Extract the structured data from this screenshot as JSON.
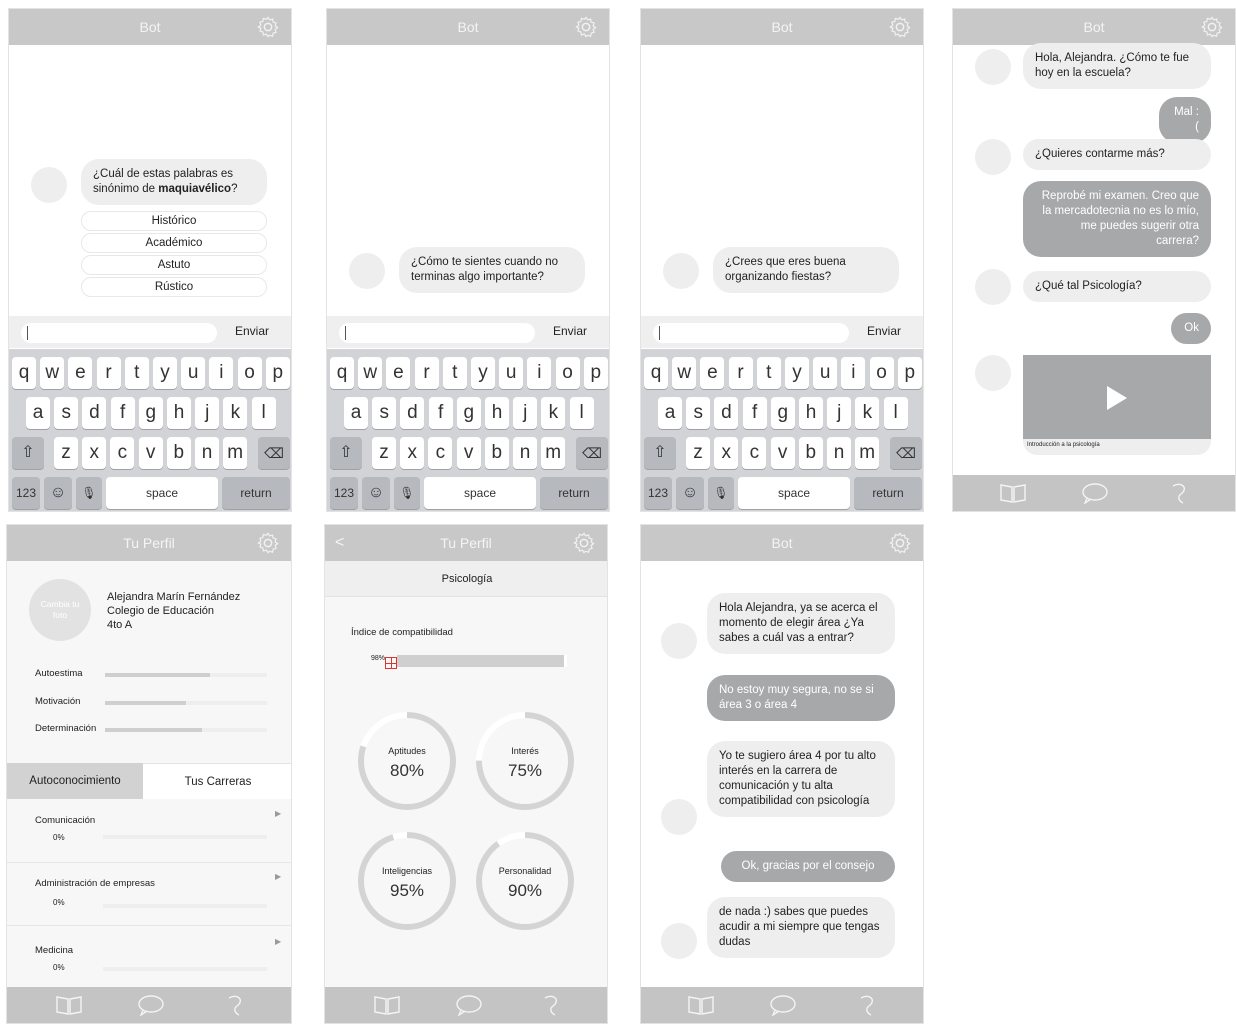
{
  "bot_title": "Bot",
  "profile_title": "Tu Perfil",
  "keyboard": {
    "row1": [
      "q",
      "w",
      "e",
      "r",
      "t",
      "y",
      "u",
      "i",
      "o",
      "p"
    ],
    "row2": [
      "a",
      "s",
      "d",
      "f",
      "g",
      "h",
      "j",
      "k",
      "l"
    ],
    "row3": [
      "z",
      "x",
      "c",
      "v",
      "b",
      "n",
      "m"
    ],
    "num_label": "123",
    "space_label": "space",
    "return_label": "return"
  },
  "send_label": "Enviar",
  "screen1": {
    "question": "¿Cuál de estas palabras es sinónimo de maquiavélico?",
    "question_prefix": "¿Cuál de estas palabras es sinónimo de ",
    "question_bold": "maquiavélico",
    "question_suffix": "?",
    "options": [
      "Histórico",
      "Académico",
      "Astuto",
      "Rústico"
    ]
  },
  "screen2": {
    "message": "¿Cómo te sientes cuando no terminas algo importante?"
  },
  "screen3": {
    "message": "¿Crees que eres buena organizando fiestas?"
  },
  "screen4": {
    "messages": [
      {
        "from": "bot",
        "text": "Hola, Alejandra. ¿Cómo te fue hoy en la escuela?"
      },
      {
        "from": "user",
        "text": "Mal :("
      },
      {
        "from": "bot",
        "text": "¿Quieres contarme más?"
      },
      {
        "from": "user",
        "text": "Reprobé mi examen. Creo que la mercadotecnia no es lo mío, me puedes sugerir otra carrera?"
      },
      {
        "from": "bot",
        "text": "¿Qué tal Psicología?"
      },
      {
        "from": "user",
        "text": "Ok"
      }
    ],
    "video_caption": "Introducción a la psicología"
  },
  "screen5": {
    "avatar_label": "Cambia tu foto",
    "name": "Alejandra Marín Fernández",
    "school": "Colegio de Educación",
    "grade": "4to A",
    "traits": [
      {
        "label": "Autoestima",
        "level": 0.65
      },
      {
        "label": "Motivación",
        "level": 0.5
      },
      {
        "label": "Determinación",
        "level": 0.6
      }
    ],
    "tabs": [
      "Autoconocimiento",
      "Tus Carreras"
    ],
    "careers": [
      {
        "label": "Comunicación",
        "percent": "0%"
      },
      {
        "label": "Administración de empresas",
        "percent": "0%"
      },
      {
        "label": "Medicina",
        "percent": "0%"
      }
    ]
  },
  "screen6": {
    "subtitle": "Psicología",
    "index_label": "Índice de compatibilidad",
    "index_value": "98%",
    "index_level": 0.98,
    "rings": [
      {
        "label": "Aptitudes",
        "value": "80%",
        "level": 0.8
      },
      {
        "label": "Interés",
        "value": "75%",
        "level": 0.75
      },
      {
        "label": "Inteligencias",
        "value": "95%",
        "level": 0.95
      },
      {
        "label": "Personalidad",
        "value": "90%",
        "level": 0.9
      }
    ]
  },
  "screen7": {
    "messages": [
      {
        "from": "bot",
        "text": "Hola Alejandra, ya se acerca el momento de elegir área ¿Ya sabes a cuál vas a entrar?"
      },
      {
        "from": "user",
        "text": "No estoy muy segura, no se si área 3 o área 4"
      },
      {
        "from": "bot",
        "text": "Yo te sugiero área 4 por tu alto interés en la carrera de comunicación y tu alta compatibilidad con psicología"
      },
      {
        "from": "user",
        "text": "Ok, gracias por el consejo"
      },
      {
        "from": "bot",
        "text": "de nada :) sabes que puedes acudir a mi siempre que tengas dudas"
      }
    ]
  },
  "colors": {
    "header": "#c8c8c9",
    "bubble": "#eeeeee",
    "bubble_user": "#a7a8a9",
    "keyboard": "#d1d3d6"
  },
  "icons": [
    "gear-icon",
    "book-icon",
    "chat-bubble-icon",
    "swirl-icon",
    "play-icon",
    "backspace-icon",
    "shift-icon",
    "emoji-icon",
    "mic-icon"
  ]
}
